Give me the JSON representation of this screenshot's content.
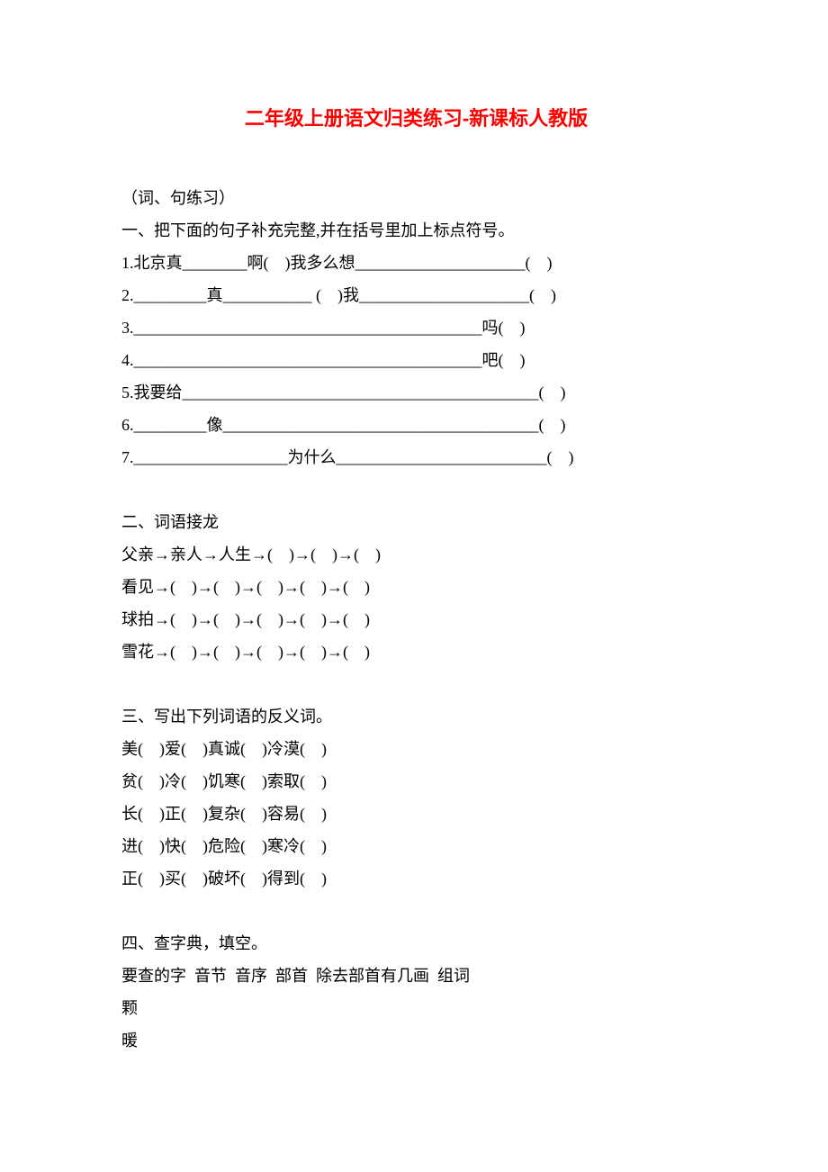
{
  "title": "二年级上册语文归类练习-新课标人教版",
  "subtitle": "（词、句练习）",
  "section1": {
    "heading": "一、把下面的句子补充完整,并在括号里加上标点符号。",
    "items": [
      "1.北京真________啊(    )我多么想_____________________(    )",
      "2._________真___________ (    )我_____________________(    )",
      "3.___________________________________________吗(    )",
      "4.___________________________________________吧(    )",
      "5.我要给____________________________________________(    )",
      "6._________像_______________________________________(    )",
      "7.___________________为什么__________________________(    )"
    ]
  },
  "section2": {
    "heading": "二、词语接龙",
    "items": [
      "父亲→亲人→人生→(    )→(    )→(    )",
      "看见→(    )→(    )→(    )→(    )→(    )",
      "球拍→(    )→(    )→(    )→(    )→(    )",
      "雪花→(    )→(    )→(    )→(    )→(    )"
    ]
  },
  "section3": {
    "heading": "三、写出下列词语的反义词。",
    "items": [
      "美(    )爱(    )真诚(    )冷漠(    )",
      "贫(    )冷(    )饥寒(    )索取(    )",
      "长(    )正(    )复杂(    )容易(    )",
      "进(    )快(    )危险(    )寒冷(    )",
      "正(    )买(    )破坏(    )得到(    )"
    ]
  },
  "section4": {
    "heading": "四、查字典，填空。",
    "header_row": "要查的字  音节  音序  部首  除去部首有几画  组词",
    "rows": [
      "颗",
      "暖"
    ]
  }
}
